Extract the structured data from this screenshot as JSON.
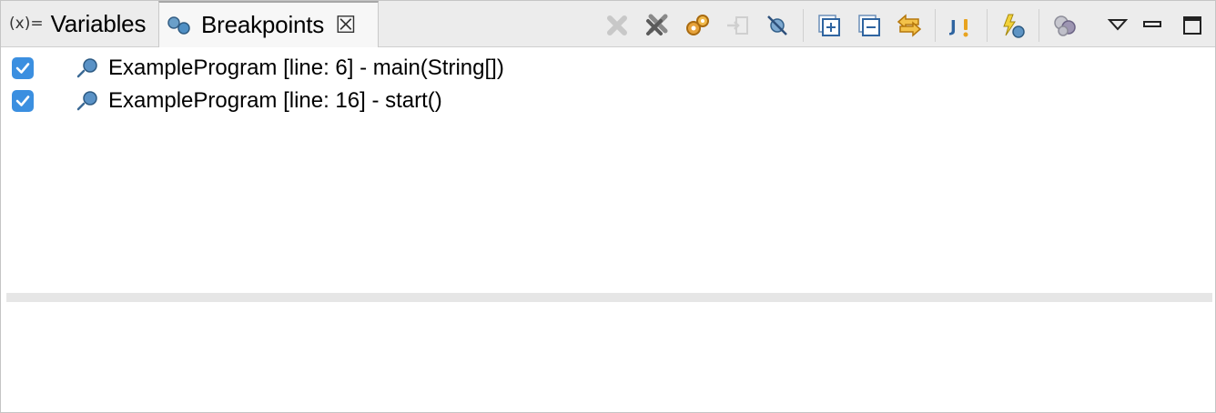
{
  "tabs": [
    {
      "label": "Variables",
      "glyph": "(x)="
    },
    {
      "label": "Breakpoints",
      "close": "☒"
    }
  ],
  "toolbar": {
    "buttons": [
      {
        "icon": "remove-icon"
      },
      {
        "icon": "remove-all-icon"
      },
      {
        "icon": "link-gears-icon"
      },
      {
        "icon": "go-to-file-icon"
      },
      {
        "icon": "skip-all-icon"
      },
      {
        "icon": "expand-all-icon"
      },
      {
        "icon": "collapse-all-icon"
      },
      {
        "icon": "link-with-view-icon"
      },
      {
        "icon": "java-exception-icon"
      },
      {
        "icon": "breakpoint-types-icon"
      },
      {
        "icon": "show-supported-icon"
      },
      {
        "icon": "view-menu-icon"
      },
      {
        "icon": "minimize-icon"
      },
      {
        "icon": "maximize-icon"
      }
    ]
  },
  "breakpoints": [
    {
      "checked": true,
      "text": "ExampleProgram [line: 6] - main(String[])"
    },
    {
      "checked": true,
      "text": "ExampleProgram [line: 16] - start()"
    }
  ],
  "colors": {
    "accent": "#3b8fe0",
    "tabbar": "#ececec"
  }
}
